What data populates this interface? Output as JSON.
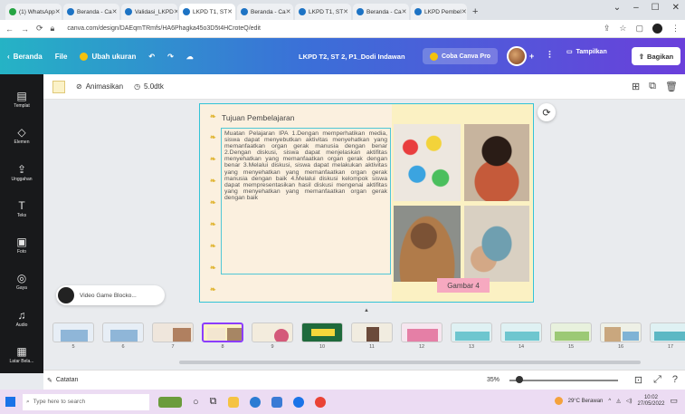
{
  "browser": {
    "tabs": [
      {
        "label": "(1) WhatsApp",
        "active": false
      },
      {
        "label": "Beranda - Ca",
        "active": false
      },
      {
        "label": "Validasi_LKPD",
        "active": false
      },
      {
        "label": "LKPD T1, ST",
        "active": true
      },
      {
        "label": "Beranda - Ca",
        "active": false
      },
      {
        "label": "LKPD T1, ST",
        "active": false
      },
      {
        "label": "Beranda - Ca",
        "active": false
      },
      {
        "label": "LKPD Pembel",
        "active": false
      }
    ],
    "new_tab": "+",
    "url": "canva.com/design/DAEqmTRmfs/HA6Phagka45o3D5t4HCroteQ/edit"
  },
  "canva_header": {
    "back_label": "Beranda",
    "file_label": "File",
    "resize_label": "Ubah ukuran",
    "doc_title": "LKPD T2, ST 2, P1_Dodi Indawan",
    "trial_label": "Coba Canva Pro",
    "present_label": "Tampilkan",
    "share_label": "Bagikan"
  },
  "sidebar": {
    "items": [
      {
        "label": "Templat",
        "icon": "layout-icon"
      },
      {
        "label": "Elemen",
        "icon": "shapes-icon"
      },
      {
        "label": "Unggahan",
        "icon": "upload-icon"
      },
      {
        "label": "Teks",
        "icon": "text-icon"
      },
      {
        "label": "Foto",
        "icon": "photo-icon"
      },
      {
        "label": "Gaya",
        "icon": "palette-icon"
      },
      {
        "label": "Audio",
        "icon": "music-icon"
      },
      {
        "label": "Latar Bela...",
        "icon": "background-icon"
      }
    ]
  },
  "toolbar": {
    "animate_label": "Animasikan",
    "duration_label": "5.0dtk",
    "swatch_color": "#fbf2c8"
  },
  "slide": {
    "title": "Tujuan Pembelajaran",
    "body": "Muatan Pelajaran IPA 1.Dengan memperhatikan media, siswa dapat menyebutkan aktivitas menyehatkan yang memanfaatkan organ gerak manusia dengan benar 2.Dengan diskusi, siswa dapat menjelaskan aktifitas menyehatkan yang memanfaatkan organ gerak dengan benar 3.Melalui diskusi, siswa dapat melakukan aktivitas yang menyehatkan yang memanfaatkan organ gerak manusia dengan baik 4.Melalui diskusi kelompok siswa dapat mempresentasikan hasil diskusi mengenai aktifitas yang menyehatkan yang memanfaatkan organ gerak dengan baik",
    "caption": "Gambar 4",
    "accent": "#33c3d6"
  },
  "video_chip": {
    "label": "Video Game Blocko..."
  },
  "pages": {
    "numbers": [
      "5",
      "6",
      "7",
      "8",
      "9",
      "10",
      "11",
      "12",
      "13",
      "14",
      "15",
      "16",
      "17"
    ],
    "selected": "8"
  },
  "notes_bar": {
    "notes_label": "Catatan",
    "zoom": "35%"
  },
  "taskbar": {
    "search_placeholder": "Type here to search",
    "weather": "29°C Berawan",
    "time": "10:02",
    "date": "27/05/2022"
  }
}
